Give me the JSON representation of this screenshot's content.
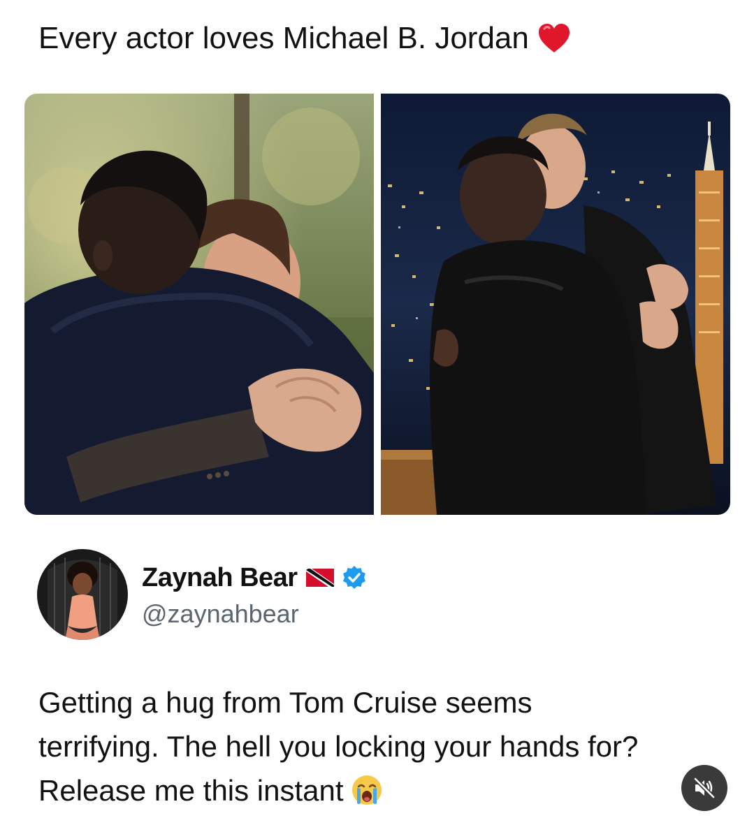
{
  "post": {
    "caption": "Every actor loves Michael B. Jordan",
    "caption_emoji": "heart-icon"
  },
  "photos": [
    {
      "name": "photo-left",
      "description_icon": "photo-hug-outdoor"
    },
    {
      "name": "photo-right",
      "description_icon": "photo-hug-talkshow"
    }
  ],
  "tweet": {
    "display_name": "Zaynah Bear",
    "handle": "@zaynahbear",
    "flag_icon": "trinidad-flag-icon",
    "verified_icon": "verified-badge-icon",
    "text_lines": [
      "Getting a hug from Tom Cruise seems",
      "terrifying. The hell you locking your hands for?",
      "Release me this instant"
    ],
    "text_emoji": "loudly-crying-face-icon"
  },
  "controls": {
    "mute_icon": "speaker-muted-icon"
  },
  "colors": {
    "verified_blue": "#1d9bf0",
    "handle_gray": "#5b6570",
    "mute_bg": "#3a3a3a",
    "heart_red": "#e0162b"
  }
}
